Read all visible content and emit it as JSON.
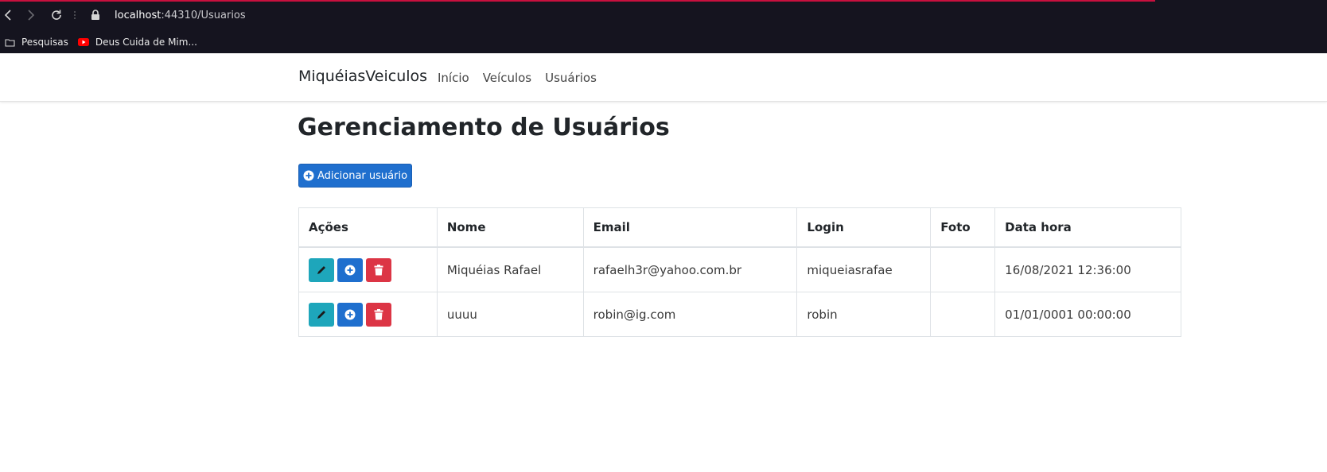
{
  "browser": {
    "url_host": "localhost",
    "url_path": ":44310/Usuarios",
    "bookmarks": [
      {
        "label": "Pesquisas",
        "icon": "folder-icon"
      },
      {
        "label": "Deus Cuida de Mim...",
        "icon": "youtube-icon"
      }
    ],
    "accent_color": "#c8103e"
  },
  "navbar": {
    "brand": "MiquéiasVeiculos",
    "links": [
      "Início",
      "Veículos",
      "Usuários"
    ]
  },
  "page": {
    "title": "Gerenciamento de Usuários",
    "add_button": "Adicionar usuário"
  },
  "table": {
    "headers": [
      "Ações",
      "Nome",
      "Email",
      "Login",
      "Foto",
      "Data hora"
    ],
    "rows": [
      {
        "nome": "Miquéias Rafael",
        "email": "rafaelh3r@yahoo.com.br",
        "login": "miqueiasrafae",
        "foto": "",
        "data_hora": "16/08/2021 12:36:00"
      },
      {
        "nome": "uuuu",
        "email": "robin@ig.com",
        "login": "robin",
        "foto": "",
        "data_hora": "01/01/0001 00:00:00"
      }
    ],
    "action_icons": [
      "pencil-icon",
      "plus-circle-icon",
      "trash-icon"
    ]
  },
  "colors": {
    "primary": "#1f6fce",
    "info": "#1ea6bb",
    "danger": "#dc3545",
    "browser_bg": "#15141f"
  }
}
